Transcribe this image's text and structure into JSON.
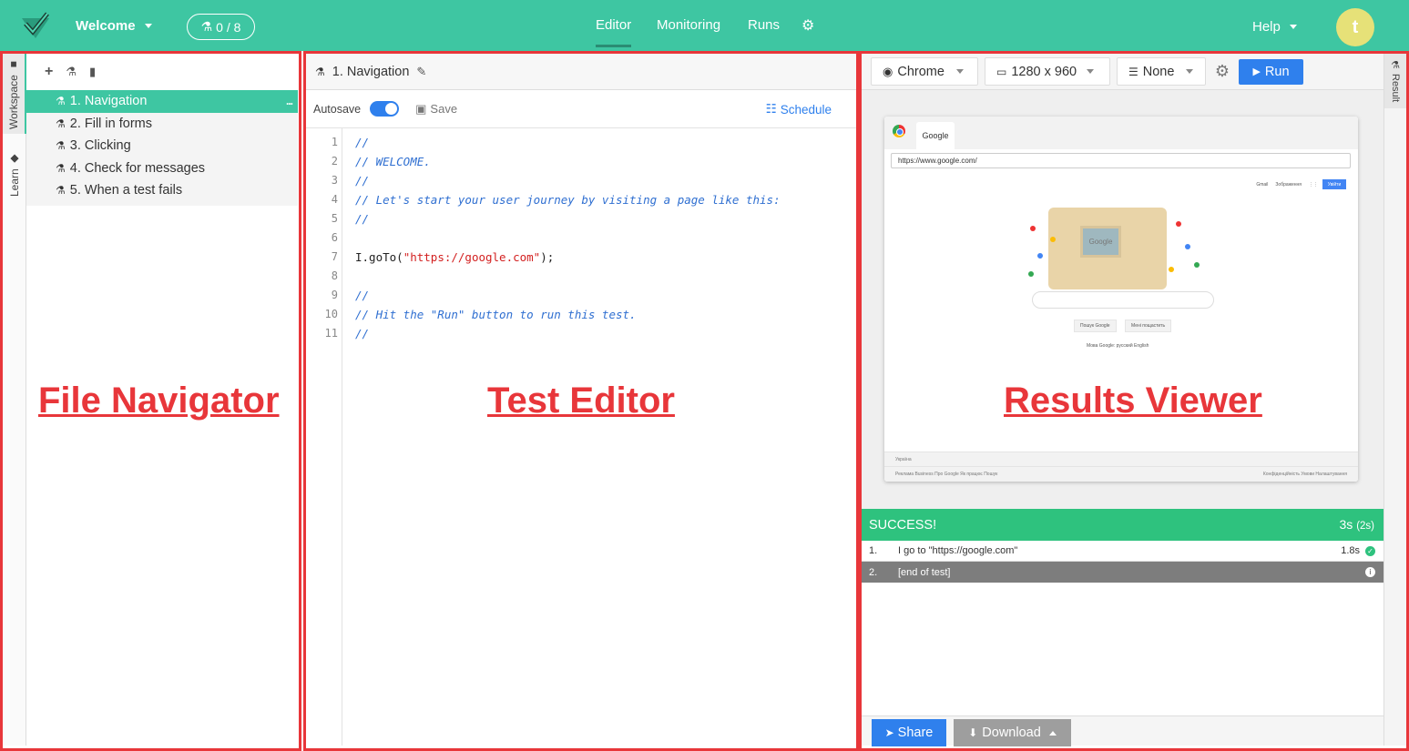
{
  "topbar": {
    "project_label": "Welcome",
    "counter": "0 / 8",
    "nav": {
      "editor": "Editor",
      "monitoring": "Monitoring",
      "runs": "Runs"
    },
    "help": "Help",
    "avatar_letter": "t",
    "accent_color": "#3ec6a2"
  },
  "sidetabs": {
    "workspace": "Workspace",
    "learn": "Learn"
  },
  "navigator": {
    "files": [
      "1. Navigation",
      "2. Fill in forms",
      "3. Clicking",
      "4. Check for messages",
      "5. When a test fails"
    ],
    "selected_index": 0,
    "more_icon": "..."
  },
  "labels": {
    "file_navigator": "File Navigator",
    "test_editor": "Test Editor",
    "results_viewer": "Results Viewer"
  },
  "editor": {
    "filename": "1. Navigation",
    "autosave_label": "Autosave",
    "autosave_on": true,
    "save_label": "Save",
    "schedule_label": "Schedule",
    "line_numbers": [
      "1",
      "2",
      "3",
      "4",
      "5",
      "6",
      "7",
      "8",
      "9",
      "10",
      "11"
    ],
    "lines": [
      {
        "comment": "//"
      },
      {
        "comment": "// WELCOME."
      },
      {
        "comment": "//"
      },
      {
        "comment": "// Let's start your user journey by visiting a page like this:"
      },
      {
        "comment": "//"
      },
      {
        "plain": ""
      },
      {
        "code_pre": "I.goTo(",
        "code_str": "\"https://google.com\"",
        "code_post": ");"
      },
      {
        "plain": ""
      },
      {
        "comment": "//"
      },
      {
        "comment": "// Hit the \"Run\" button to run this test."
      },
      {
        "comment": "//"
      }
    ]
  },
  "results": {
    "browser": "Chrome",
    "resolution": "1280 x 960",
    "network": "None",
    "run_label": "Run",
    "preview": {
      "tab_title": "Google",
      "url": "https://www.google.com/",
      "top_links": [
        "Gmail",
        "Зображення"
      ],
      "sign_in": "Увійти",
      "doodle_text": "Google",
      "buttons": [
        "Пошук Google",
        "Мені пощастить"
      ],
      "languages": "Мова Google:  русский  English",
      "footer_country": "Україна",
      "footer_left": "Реклама    Business    Про Google    Як працює Пошук",
      "footer_right": "Конфіденційність    Умови    Налаштування"
    },
    "status": "SUCCESS!",
    "total_time": "3s",
    "sub_time": "(2s)",
    "steps": [
      {
        "num": "1.",
        "text": "I go to \"https://google.com\"",
        "duration": "1.8s",
        "state": "ok"
      },
      {
        "num": "2.",
        "text": "[end of test]",
        "duration": "",
        "state": "info"
      }
    ],
    "share_label": "Share",
    "download_label": "Download",
    "result_tab": "Result",
    "success_color": "#2ec27e"
  }
}
